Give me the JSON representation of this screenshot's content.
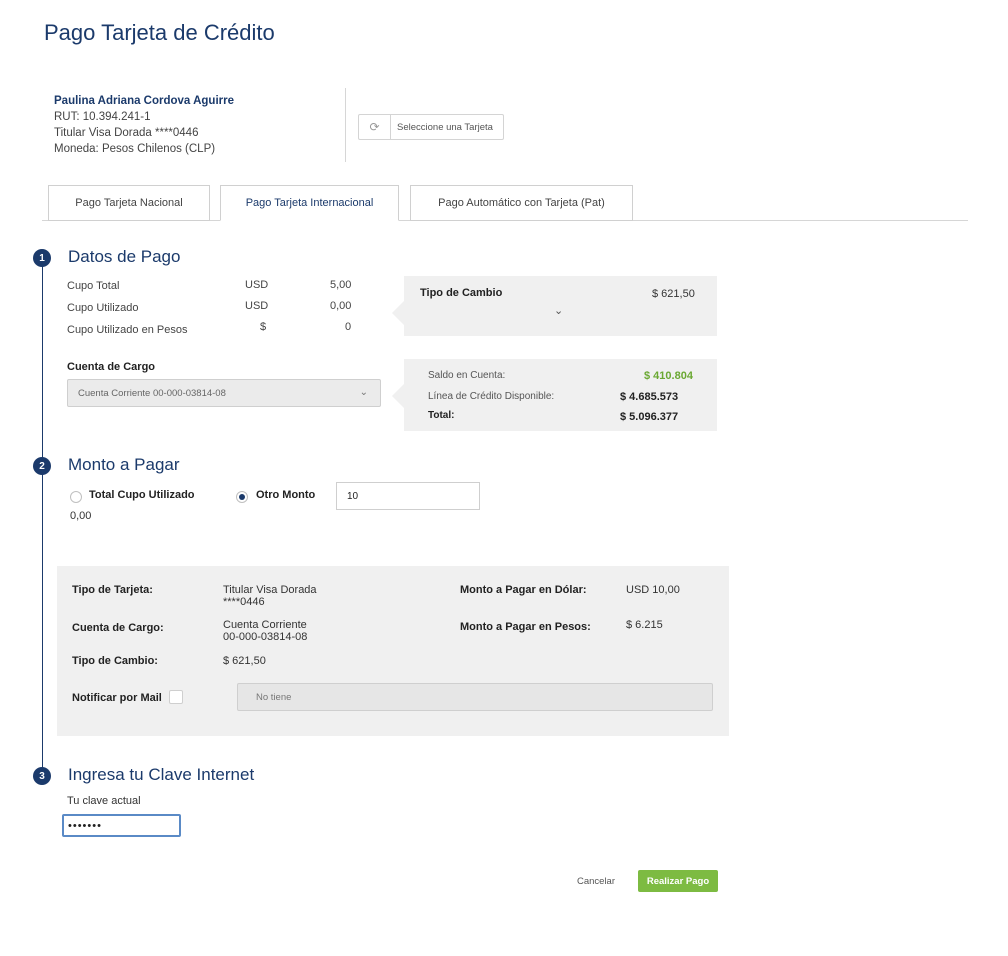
{
  "page": {
    "title": "Pago Tarjeta de Crédito"
  },
  "user": {
    "name": "Paulina Adriana Cordova Aguirre",
    "rut": "RUT: 10.394.241-1",
    "card": "Titular Visa Dorada ****0446",
    "currency": "Moneda: Pesos Chilenos (CLP)"
  },
  "card_selector": {
    "label": "Seleccione una Tarjeta",
    "icon": "refresh-card-icon"
  },
  "tabs": [
    {
      "label": "Pago Tarjeta Nacional",
      "active": false
    },
    {
      "label": "Pago Tarjeta Internacional",
      "active": true
    },
    {
      "label": "Pago Automático con Tarjeta (Pat)",
      "active": false
    }
  ],
  "steps": [
    {
      "number": "1",
      "title": "Datos de Pago"
    },
    {
      "number": "2",
      "title": "Monto a Pagar"
    },
    {
      "number": "3",
      "title": "Ingresa tu Clave Internet"
    }
  ],
  "cupo": {
    "rows": [
      {
        "label": "Cupo Total",
        "currency": "USD",
        "value": "5,00"
      },
      {
        "label": "Cupo Utilizado",
        "currency": "USD",
        "value": "0,00"
      },
      {
        "label": "Cupo Utilizado en Pesos",
        "currency": "$",
        "value": "0"
      }
    ]
  },
  "exchange": {
    "label": "Tipo de Cambio",
    "value": "$ 621,50"
  },
  "account": {
    "label": "Cuenta de Cargo",
    "selected": "Cuenta Corriente 00-000-03814-08",
    "balance_label": "Saldo en Cuenta:",
    "balance_value": "$ 410.804",
    "credit_label": "Línea de Crédito Disponible:",
    "credit_value": "$ 4.685.573",
    "total_label": "Total:",
    "total_value": "$ 5.096.377",
    "balance_color": "#6aa832"
  },
  "amount": {
    "option1_label": "Total Cupo Utilizado",
    "option1_value": "0,00",
    "option2_label": "Otro Monto",
    "option2_input": "10",
    "selected": "Otro Monto"
  },
  "summary": {
    "card_type_label": "Tipo de Tarjeta:",
    "card_type_value": "Titular Visa Dorada\n****0446",
    "account_label": "Cuenta de Cargo:",
    "account_value": "Cuenta Corriente\n00-000-03814-08",
    "exchange_label": "Tipo de Cambio:",
    "exchange_value": "$ 621,50",
    "usd_label": "Monto a Pagar en Dólar:",
    "usd_value": "USD 10,00",
    "clp_label": "Monto a Pagar en Pesos:",
    "clp_value": "$ 6.215",
    "notify_label": "Notificar por Mail",
    "mail_placeholder": "No tiene"
  },
  "password": {
    "label": "Tu clave actual",
    "value": "•••••••"
  },
  "actions": {
    "cancel": "Cancelar",
    "submit": "Realizar Pago",
    "submit_color": "#7dbb42"
  },
  "colors": {
    "primary": "#1b3a6b"
  }
}
